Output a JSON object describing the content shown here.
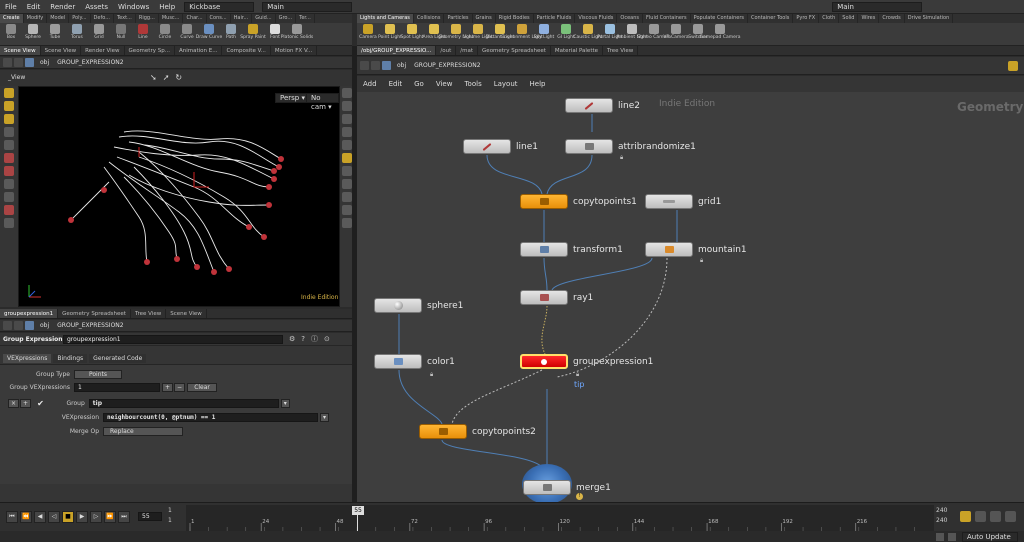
{
  "menubar": {
    "items": [
      "File",
      "Edit",
      "Render",
      "Assets",
      "Windows",
      "Help"
    ],
    "desktop": "Kickbase",
    "workspace": "Main",
    "right_workspace": "Main"
  },
  "shelf_left": {
    "tabs": [
      "Create",
      "Modify",
      "Model",
      "Poly...",
      "Defo...",
      "Text...",
      "Rigg...",
      "Musc...",
      "Char...",
      "Cons...",
      "Hair...",
      "Guid...",
      "Gro...",
      "Ter..."
    ],
    "tools": [
      "Box",
      "Sphere",
      "Tube",
      "Torus",
      "Grid",
      "Null",
      "Line",
      "Circle",
      "Curve",
      "Draw Curve",
      "Path",
      "Spray Paint",
      "Font",
      "Platonic Solids"
    ]
  },
  "shelf_right": {
    "tabs": [
      "Lights and Cameras",
      "Collisions",
      "Particles",
      "Grains",
      "Rigid Bodies",
      "Particle Fluids",
      "Viscous Fluids",
      "Oceans",
      "Fluid Containers",
      "Populate Containers",
      "Container Tools",
      "Pyro FX",
      "Cloth",
      "Solid",
      "Wires",
      "Crowds",
      "Drive Simulation"
    ],
    "tools": [
      "Camera",
      "Point Light",
      "Spot Light",
      "Area Light",
      "Geometry Light",
      "Volume Light",
      "Distant Light",
      "Environment Light",
      "Sky Light",
      "GI Light",
      "Caustic Light",
      "Portal Light",
      "Ambient Light",
      "Stereo Camera",
      "VR Camera",
      "Switcher",
      "Gamepad Camera"
    ]
  },
  "left_pane_tabs": [
    "Scene View",
    "Scene View",
    "Render View",
    "Geometry Sp...",
    "Animation E...",
    "Composite V...",
    "Motion FX V..."
  ],
  "path_left": {
    "obj": "obj",
    "node": "GROUP_EXPRESSION2"
  },
  "viewport": {
    "title": "_View",
    "persp": "Persp ▾",
    "cam": "No cam ▾",
    "edition": "Indie Edition"
  },
  "param_pane_tabs": [
    "groupexpression1",
    "Geometry Spreadsheet",
    "Tree View",
    "Scene View"
  ],
  "path_param": {
    "obj": "obj",
    "node": "GROUP_EXPRESSION2"
  },
  "params": {
    "node_type": "Group Expression",
    "node_name": "groupexpression1",
    "tabs": [
      "VEXpressions",
      "Bindings",
      "Generated Code"
    ],
    "group_type_label": "Group Type",
    "group_type_value": "Points",
    "group_vex_label": "Group VEXpressions",
    "group_vex_value": "1",
    "clear_label": "Clear",
    "group_label": "Group",
    "group_value": "tip",
    "vexpression_label": "VEXpression",
    "vexpression_value": "neighbourcount(0, @ptnum) == 1",
    "merge_label": "Merge Op",
    "merge_value": "Replace"
  },
  "right_pane_tabs": [
    "/obj/GROUP_EXPRESSIO...",
    "/out",
    "/mat",
    "Geometry Spreadsheet",
    "Material Palette",
    "Tree View"
  ],
  "path_right": {
    "obj": "obj",
    "node": "GROUP_EXPRESSION2"
  },
  "network_menu": [
    "Add",
    "Edit",
    "Go",
    "View",
    "Tools",
    "Layout",
    "Help"
  ],
  "network": {
    "watermark": "Indie Edition",
    "context": "Geometry",
    "nodes": {
      "line2": "line2",
      "line1": "line1",
      "attribrandomize1": "attribrandomize1",
      "copytopoints1": "copytopoints1",
      "grid1": "grid1",
      "transform1": "transform1",
      "mountain1": "mountain1",
      "ray1": "ray1",
      "sphere1": "sphere1",
      "color1": "color1",
      "groupexpression1": "groupexpression1",
      "groupexpression1_group": "tip",
      "copytopoints2": "copytopoints2",
      "merge1": "merge1"
    }
  },
  "timeline": {
    "current_frame": "55",
    "start": "1",
    "start2": "1",
    "ticks": [
      "1",
      "24",
      "48",
      "72",
      "96",
      "120",
      "144",
      "168",
      "192",
      "216"
    ],
    "playhead": "55",
    "end": "240",
    "end2": "240",
    "auto_update": "Auto Update"
  },
  "colors": {
    "accent": "#c9a227",
    "node_orange": "#f5a623",
    "node_red": "#e60000",
    "wire_blue": "#4f7fb5"
  }
}
